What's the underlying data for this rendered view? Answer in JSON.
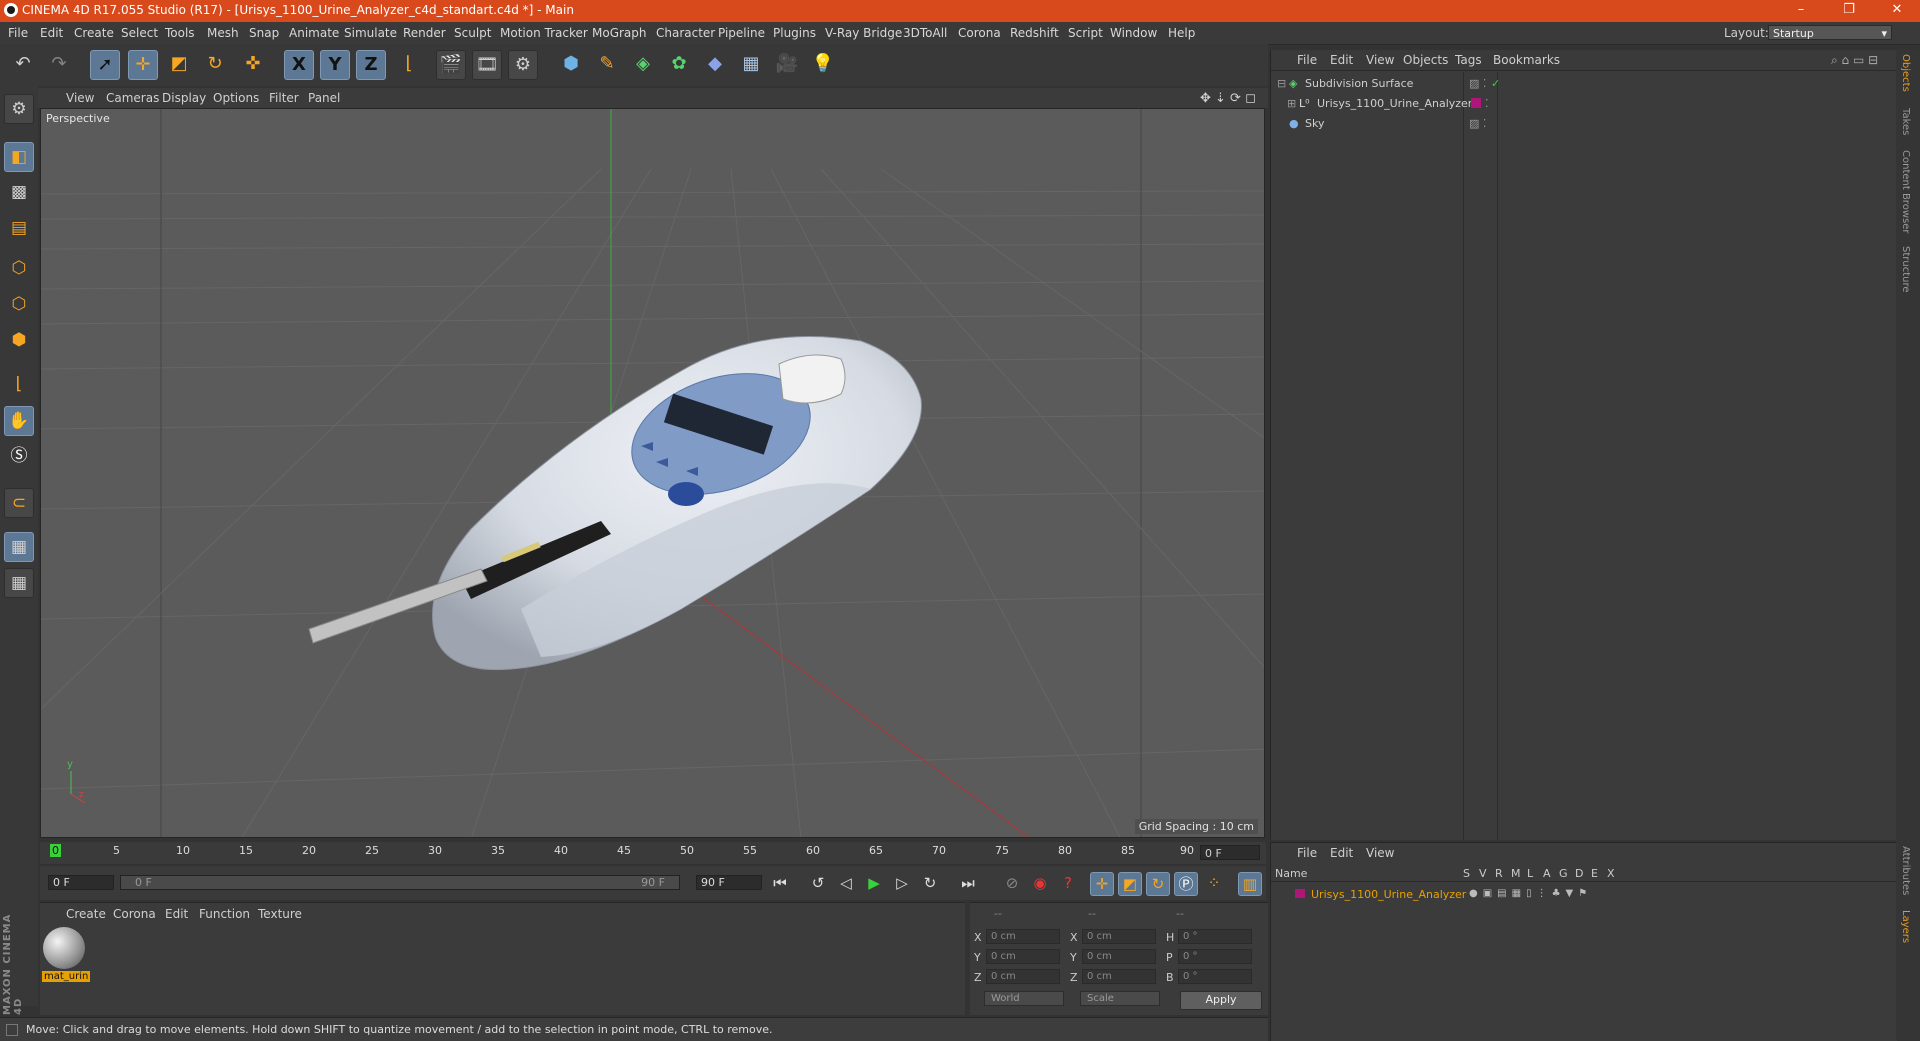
{
  "window": {
    "title": "CINEMA 4D R17.055 Studio (R17) - [Urisys_1100_Urine_Analyzer_c4d_standart.c4d *] - Main",
    "minimize": "–",
    "maximize": "❐",
    "close": "✕"
  },
  "menubar": {
    "items": [
      "File",
      "Edit",
      "Create",
      "Select",
      "Tools",
      "Mesh",
      "Snap",
      "Animate",
      "Simulate",
      "Render",
      "Sculpt",
      "Motion Tracker",
      "MoGraph",
      "Character",
      "Pipeline",
      "Plugins",
      "V-Ray Bridge",
      "3DToAll",
      "Corona",
      "Redshift",
      "Script",
      "Window",
      "Help"
    ],
    "layout_label": "Layout:",
    "layout_value": "Startup"
  },
  "toolbar": {
    "icons": [
      "undo-icon",
      "redo-icon",
      "select-cursor-icon",
      "move-icon",
      "scale-icon",
      "rotate-icon",
      "live-select-icon",
      "x-axis-icon",
      "y-axis-icon",
      "z-axis-icon",
      "coordinate-system-icon",
      "render-view-icon",
      "render-picture-viewer-icon",
      "edit-render-settings-icon",
      "cube-icon",
      "spline-pen-icon",
      "subdivision-icon",
      "cloner-icon",
      "deformer-icon",
      "floor-icon",
      "camera-icon",
      "light-icon"
    ],
    "axis_x": "X",
    "axis_y": "Y",
    "axis_z": "Z"
  },
  "viewport": {
    "menu": [
      "View",
      "Cameras",
      "Display",
      "Options",
      "Filter",
      "Panel"
    ],
    "label": "Perspective",
    "grid_spacing": "Grid Spacing : 10 cm"
  },
  "timeline": {
    "ticks": [
      "0",
      "5",
      "10",
      "15",
      "20",
      "25",
      "30",
      "35",
      "40",
      "45",
      "50",
      "55",
      "60",
      "65",
      "70",
      "75",
      "80",
      "85",
      "90"
    ],
    "current_frame": "0 F",
    "start_field": "0 F",
    "range_start": "0 F",
    "range_end": "90 F",
    "end_field": "90 F"
  },
  "material_manager": {
    "menu": [
      "Create",
      "Corona",
      "Edit",
      "Function",
      "Texture"
    ],
    "material_name": "mat_urin"
  },
  "coordinates": {
    "headers": [
      "--",
      "--",
      "--"
    ],
    "rows": [
      {
        "a": "X",
        "av": "0 cm",
        "b": "X",
        "bv": "0 cm",
        "c": "H",
        "cv": "0 °"
      },
      {
        "a": "Y",
        "av": "0 cm",
        "b": "Y",
        "bv": "0 cm",
        "c": "P",
        "cv": "0 °"
      },
      {
        "a": "Z",
        "av": "0 cm",
        "b": "Z",
        "bv": "0 cm",
        "c": "B",
        "cv": "0 °"
      }
    ],
    "mode1": "World",
    "mode2": "Scale",
    "apply": "Apply"
  },
  "status": {
    "text": "Move: Click and drag to move elements. Hold down SHIFT to quantize movement / add to the selection in point mode, CTRL to remove."
  },
  "object_manager": {
    "menu": [
      "File",
      "Edit",
      "View",
      "Objects",
      "Tags",
      "Bookmarks"
    ],
    "objects": [
      {
        "name": "Subdivision Surface",
        "icon": "subdivision-icon"
      },
      {
        "name": "Urisys_1100_Urine_Analyzer",
        "icon": "null-object-icon"
      },
      {
        "name": "Sky",
        "icon": "sky-icon"
      }
    ]
  },
  "layer_manager": {
    "menu": [
      "File",
      "Edit",
      "View"
    ],
    "col_name": "Name",
    "cols": [
      "S",
      "V",
      "R",
      "M",
      "L",
      "A",
      "G",
      "D",
      "E",
      "X"
    ],
    "layer_name": "Urisys_1100_Urine_Analyzer"
  },
  "right_tabs": [
    "Objects",
    "Takes",
    "Content Browser",
    "Structure",
    "Attributes",
    "Layers"
  ],
  "logo_text": "MAXON CINEMA 4D",
  "colors": {
    "titlebar": "#d8491b",
    "selection": "#5d7895",
    "layer_color": "#b0157a",
    "highlight": "#e8a000"
  }
}
